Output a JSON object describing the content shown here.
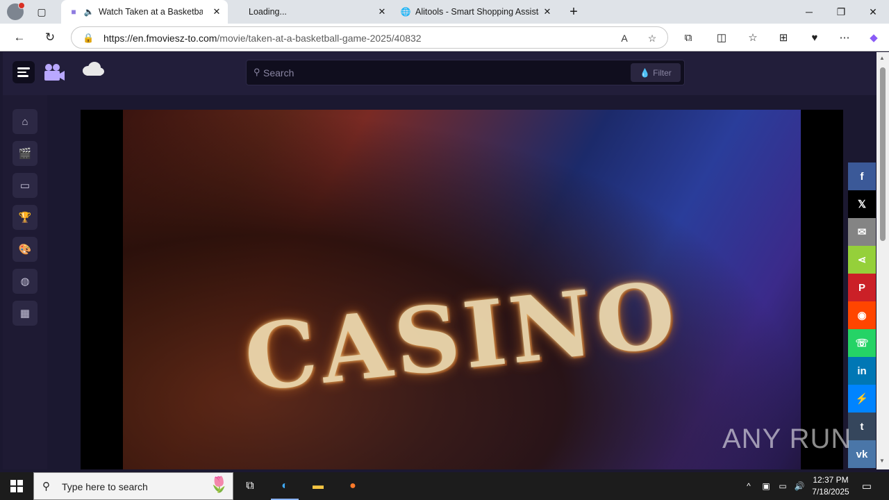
{
  "browser": {
    "tabs": [
      {
        "title": "Watch Taken at a Basketball G",
        "active": true
      },
      {
        "title": "Loading...",
        "active": false
      },
      {
        "title": "Alitools - Smart Shopping Assista",
        "active": false
      }
    ],
    "url_host": "https://en.fmoviesz-to.com",
    "url_path": "/movie/taken-at-a-basketball-game-2025/40832"
  },
  "site": {
    "search_placeholder": "Search",
    "filter_label": "Filter"
  },
  "video": {
    "sign_text": "CASINO"
  },
  "share_buttons": [
    {
      "name": "facebook",
      "glyph": "f",
      "color": "#3b5998"
    },
    {
      "name": "x-twitter",
      "glyph": "𝕏",
      "color": "#000000"
    },
    {
      "name": "email",
      "glyph": "✉",
      "color": "#848484"
    },
    {
      "name": "sharethis",
      "glyph": "⋖",
      "color": "#95d03a"
    },
    {
      "name": "pinterest",
      "glyph": "P",
      "color": "#cb2027"
    },
    {
      "name": "reddit",
      "glyph": "◉",
      "color": "#ff4500"
    },
    {
      "name": "whatsapp",
      "glyph": "☏",
      "color": "#25d366"
    },
    {
      "name": "linkedin",
      "glyph": "in",
      "color": "#0077b5"
    },
    {
      "name": "messenger",
      "glyph": "⚡",
      "color": "#0084ff"
    },
    {
      "name": "tumblr",
      "glyph": "t",
      "color": "#35465c"
    },
    {
      "name": "vk",
      "glyph": "vk",
      "color": "#4a76a8"
    }
  ],
  "watermark": "ANY RUN",
  "taskbar": {
    "search_placeholder": "Type here to search",
    "time": "12:37 PM",
    "date": "7/18/2025"
  }
}
